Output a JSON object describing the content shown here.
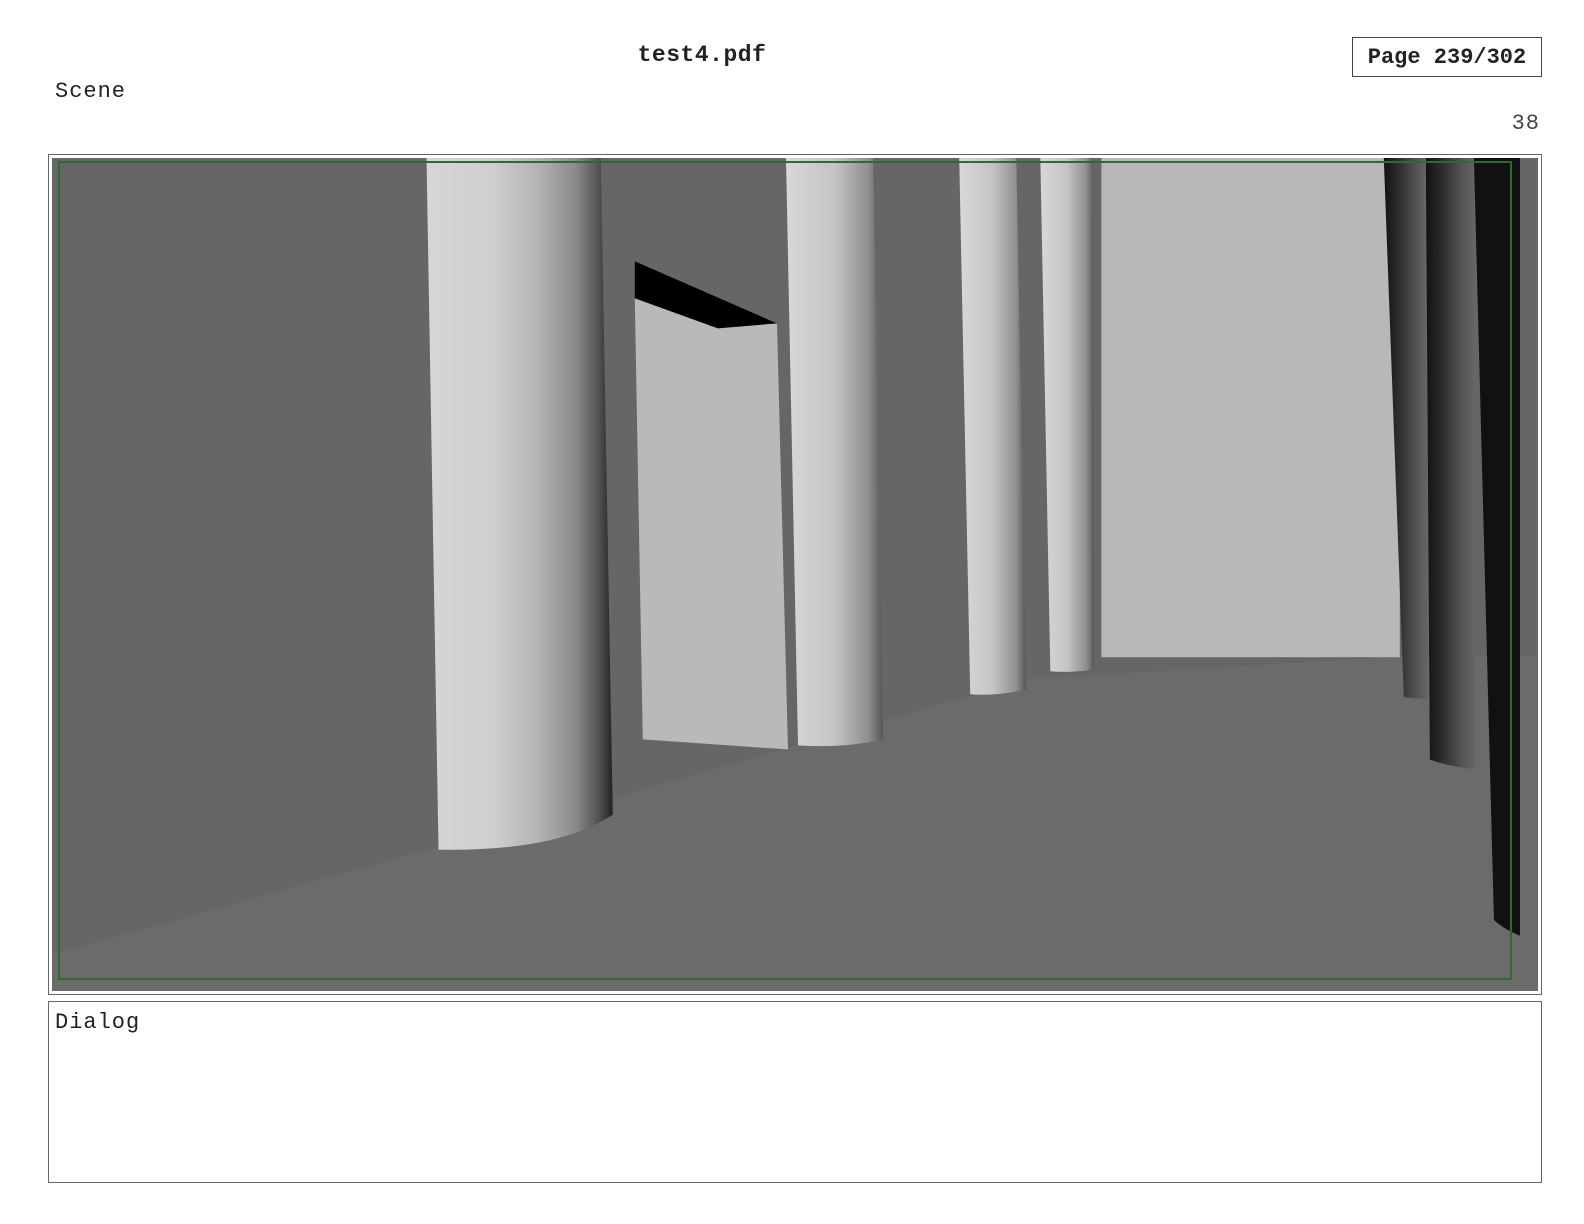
{
  "header": {
    "file_title": "test4.pdf",
    "page_indicator": "Page 239/302"
  },
  "panel": {
    "scene_label": "Scene",
    "shot_number": "38",
    "dialog_label": "Dialog",
    "dialog_text": ""
  },
  "colors": {
    "wall": "#666666",
    "floor": "#6b6b6b",
    "backwall": "#b8b8b8",
    "guide": "#2f6b2f"
  }
}
